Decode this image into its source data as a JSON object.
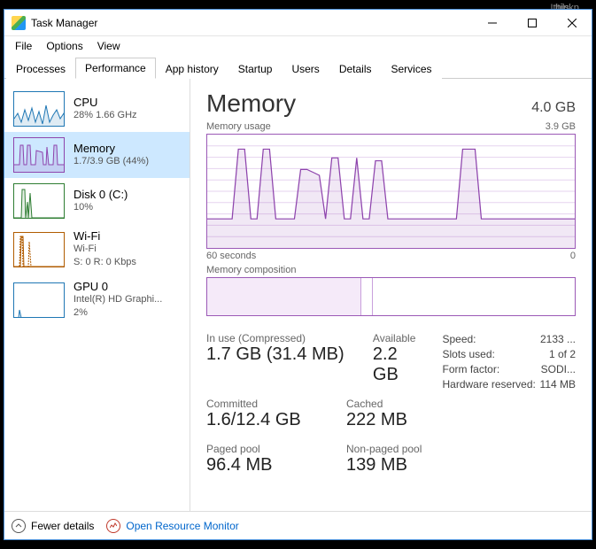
{
  "background": {
    "utils": "Utils",
    "thinkp": "thinkp..."
  },
  "window": {
    "title": "Task Manager"
  },
  "menu": {
    "file": "File",
    "options": "Options",
    "view": "View"
  },
  "tabs": [
    "Processes",
    "Performance",
    "App history",
    "Startup",
    "Users",
    "Details",
    "Services"
  ],
  "sidebar": [
    {
      "name": "CPU",
      "sub": "28% 1.66 GHz",
      "border": "#1f77b4"
    },
    {
      "name": "Memory",
      "sub": "1.7/3.9 GB (44%)",
      "border": "#8e44ad"
    },
    {
      "name": "Disk 0 (C:)",
      "sub": "10%",
      "border": "#2e7d32"
    },
    {
      "name": "Wi-Fi",
      "sub": "Wi-Fi",
      "sub2": "S: 0 R: 0 Kbps",
      "border": "#b15c00"
    },
    {
      "name": "GPU 0",
      "sub": "Intel(R) HD Graphi...",
      "sub2": "2%",
      "border": "#1f77b4"
    }
  ],
  "main": {
    "title": "Memory",
    "capacity": "4.0 GB",
    "usage_label": "Memory usage",
    "usage_max": "3.9 GB",
    "x_left": "60 seconds",
    "x_right": "0",
    "comp_label": "Memory composition"
  },
  "stats": {
    "inuse_label": "In use (Compressed)",
    "inuse_val": "1.7 GB (31.4 MB)",
    "avail_label": "Available",
    "avail_val": "2.2 GB",
    "committed_label": "Committed",
    "committed_val": "1.6/12.4 GB",
    "cached_label": "Cached",
    "cached_val": "222 MB",
    "paged_label": "Paged pool",
    "paged_val": "96.4 MB",
    "nonpaged_label": "Non-paged pool",
    "nonpaged_val": "139 MB"
  },
  "meta": {
    "speed_label": "Speed:",
    "speed_val": "2133 ...",
    "slots_label": "Slots used:",
    "slots_val": "1 of 2",
    "form_label": "Form factor:",
    "form_val": "SODI...",
    "hw_label": "Hardware reserved:",
    "hw_val": "114 MB"
  },
  "footer": {
    "fewer": "Fewer details",
    "resource": "Open Resource Monitor"
  },
  "chart_data": {
    "type": "line",
    "title": "Memory usage",
    "xlabel": "seconds",
    "ylabel": "GB",
    "xlim": [
      60,
      0
    ],
    "ylim": [
      0,
      3.9
    ],
    "series": [
      {
        "name": "Memory",
        "values_gb": [
          1.0,
          1.0,
          1.0,
          1.0,
          1.0,
          3.4,
          3.4,
          1.0,
          1.0,
          3.4,
          3.4,
          1.0,
          1.0,
          1.0,
          1.0,
          2.7,
          2.7,
          2.6,
          2.5,
          1.0,
          3.1,
          3.1,
          1.0,
          1.0,
          3.1,
          1.0,
          1.0,
          3.0,
          3.0,
          1.0,
          1.0,
          1.0,
          1.0,
          1.0,
          1.0,
          1.0,
          1.0,
          1.0,
          1.0,
          1.0,
          1.0,
          3.4,
          3.4,
          3.4,
          1.0,
          1.0,
          1.0,
          1.0,
          1.0,
          1.0,
          1.0,
          1.0,
          1.0,
          1.0,
          1.0,
          1.0,
          1.0,
          1.0,
          1.0,
          1.0
        ]
      }
    ],
    "composition_segments_pct": [
      42,
      3,
      55
    ]
  }
}
